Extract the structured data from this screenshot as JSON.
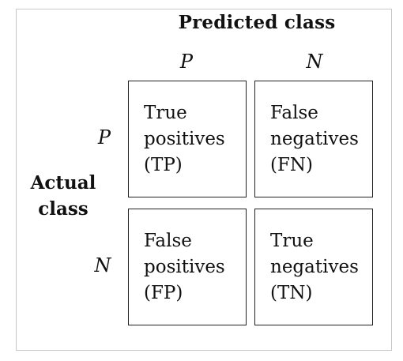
{
  "predicted_title": "Predicted class",
  "actual_title": [
    "Actual",
    "class"
  ],
  "columns": [
    "P",
    "N"
  ],
  "rows": [
    "P",
    "N"
  ],
  "cells": {
    "tp": [
      "True",
      "positives",
      "(TP)"
    ],
    "fn": [
      "False",
      "negatives",
      "(FN)"
    ],
    "fp": [
      "False",
      "positives",
      "(FP)"
    ],
    "tn": [
      "True",
      "negatives",
      "(TN)"
    ]
  }
}
